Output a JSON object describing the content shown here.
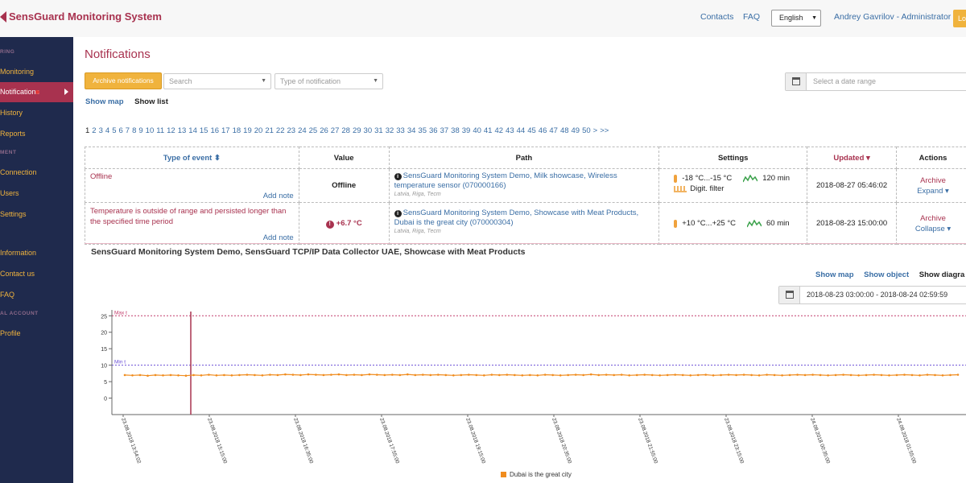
{
  "header": {
    "brand": "SensGuard Monitoring System",
    "contacts": "Contacts",
    "faq": "FAQ",
    "language": "English",
    "user": "Andrey Gavrilov - Administrator",
    "logout": "Lo"
  },
  "sidebar": {
    "heading_monitoring": "RING",
    "monitoring": "Monitoring",
    "notifications": "Notifications",
    "history": "History",
    "reports": "Reports",
    "heading_management": "MENT",
    "connection": "Connection",
    "users": "Users",
    "settings": "Settings",
    "information": "Information",
    "contact_us": "Contact us",
    "faq": "FAQ",
    "heading_account": "AL ACCOUNT",
    "profile": "Profile"
  },
  "main": {
    "title": "Notifications",
    "archive_button": "Archive notifications",
    "search_placeholder": "Search",
    "type_placeholder": "Type of notification",
    "date_placeholder": "Select a date range",
    "show_map": "Show map",
    "show_list": "Show list",
    "pager": "1 2 3 4 5 6 7 8 9 10 11 12 13 14 15 16 17 18 19 20 21 22 23 24 25 26 27 28 29 30 31 32 33 34 35 36 37 38 39 40 41 42 43 44 45 46 47 48 49 50 > >>"
  },
  "table": {
    "columns": {
      "type": "Type of event ⬍",
      "value": "Value",
      "path": "Path",
      "settings": "Settings",
      "updated": "Updated ▾",
      "actions": "Actions"
    },
    "rows": [
      {
        "type": "Offline",
        "add_note": "Add note",
        "value": "Offline",
        "path": "SensGuard Monitoring System Demo, Milk showcase, Wireless temperature sensor (070000166)",
        "location": "Latvia, Riga, Тест",
        "range": "-18 °C...-15 °C",
        "delay": "120 min",
        "filter": "Digit. filter",
        "updated": "2018-08-27 05:46:02",
        "action1": "Archive",
        "action2": "Expand ▾"
      },
      {
        "type": "Temperature is outside of range and persisted longer than the specified time period",
        "add_note": "Add note",
        "value": "+6.7 °C",
        "path": "SensGuard Monitoring System Demo, Showcase with Meat Products, Dubai is the great city (070000304)",
        "location": "Latvia, Riga, Тест",
        "range": "+10 °C...+25 °C",
        "delay": "60 min",
        "updated": "2018-08-23 15:00:00",
        "action1": "Archive",
        "action2": "Collapse ▾"
      }
    ]
  },
  "detail": {
    "title": "SensGuard Monitoring System Demo, SensGuard TCP/IP Data Collector UAE, Showcase with Meat Products",
    "show_map": "Show map",
    "show_object": "Show object",
    "show_diagram": "Show diagra",
    "range": "2018-08-23 03:00:00 - 2018-08-24 02:59:59"
  },
  "colors": {
    "brand": "#a8324f",
    "accent": "#f0b33d",
    "link": "#3a6ea5",
    "sidebar": "#1f2a4d",
    "series": "#f08c1e"
  },
  "chart_data": {
    "type": "line",
    "y_ticks": [
      0,
      5,
      10,
      15,
      20,
      25
    ],
    "ylim": [
      -5,
      28
    ],
    "max_label": "Max t",
    "min_label": "Min t",
    "max_value": 25,
    "min_value": 10,
    "x_ticks": [
      "23.08.2018 13:54:02",
      "23.08.2018 15:15:00",
      "23.08.2018 16:35:00",
      "23.08.2018 17:55:00",
      "23.08.2018 19:15:00",
      "23.08.2018 20:35:00",
      "23.08.2018 21:55:00",
      "23.08.2018 23:15:00",
      "24.08.2018 00:35:00",
      "24.08.2018 01:55:00"
    ],
    "series": [
      {
        "name": "Dubai is the great city",
        "values": [
          7.0,
          6.9,
          7.0,
          6.8,
          7.0,
          6.9,
          7.0,
          6.9,
          6.8,
          7.0,
          6.9,
          7.1,
          6.9,
          7.0,
          6.9,
          7.0,
          7.1,
          7.0,
          6.9,
          7.1,
          7.0,
          7.2,
          7.1,
          7.0,
          7.2,
          7.1,
          7.0,
          7.1,
          7.2,
          7.0,
          7.1,
          7.0,
          7.2,
          7.1,
          7.0,
          7.1,
          7.0,
          7.2,
          7.0,
          7.1,
          7.0,
          7.1,
          7.0,
          6.9,
          7.0,
          7.1,
          7.0,
          6.9,
          7.1,
          7.0,
          7.1,
          7.0,
          6.9,
          7.0,
          6.9,
          7.1,
          7.0,
          6.9,
          7.0,
          7.1,
          7.0,
          7.2,
          7.0,
          7.1,
          7.0,
          7.1,
          6.9,
          7.0,
          7.1,
          7.0,
          6.9,
          7.0,
          7.1,
          7.0,
          6.9,
          7.0,
          7.1,
          6.9,
          7.0,
          7.1,
          7.0,
          7.1,
          7.0,
          6.9,
          7.1,
          7.0,
          6.9,
          7.0,
          7.1,
          7.0,
          7.1,
          7.0,
          6.9,
          7.0,
          7.1,
          7.0,
          6.9,
          7.0,
          7.1,
          7.0,
          6.9,
          7.0,
          7.1,
          7.0,
          6.9,
          7.1,
          7.0,
          6.9,
          7.0,
          7.1
        ]
      }
    ],
    "legend": "bottom-center"
  }
}
